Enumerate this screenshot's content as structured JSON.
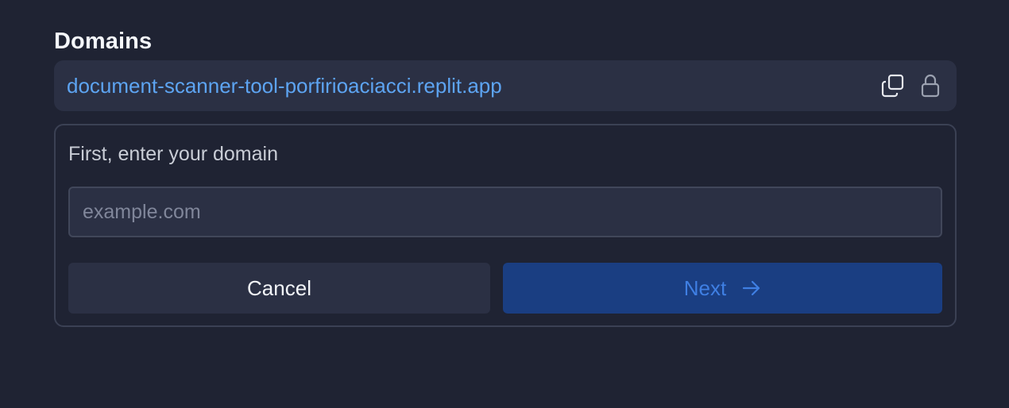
{
  "domains": {
    "title": "Domains",
    "existing_domain": "document-scanner-tool-porfirioaciacci.replit.app",
    "copy_icon": "copy-icon",
    "lock_icon": "lock-icon"
  },
  "form": {
    "label": "First, enter your domain",
    "input_value": "",
    "input_placeholder": "example.com",
    "cancel_label": "Cancel",
    "next_label": "Next",
    "next_icon": "arrow-right-icon"
  },
  "colors": {
    "background": "#1f2333",
    "surface": "#2b3044",
    "link": "#5da4f2",
    "primary_button": "#1a3e82",
    "primary_button_text": "#3f7fe3"
  }
}
